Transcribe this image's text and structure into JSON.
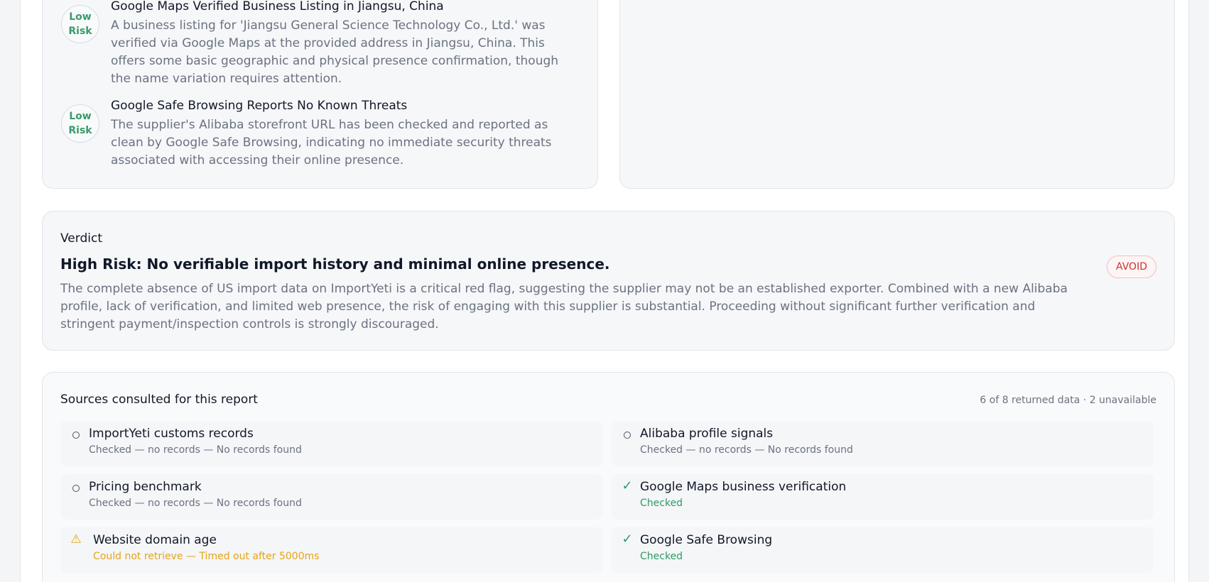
{
  "findings": [
    {
      "risk": "Low Risk",
      "title": "Google Maps Verified Business Listing in Jiangsu, China",
      "description": "A business listing for 'Jiangsu General Science Technology Co., Ltd.' was verified via Google Maps at the provided address in Jiangsu, China. This offers some basic geographic and physical presence confirmation, though the name variation requires attention."
    },
    {
      "risk": "Low Risk",
      "title": "Google Safe Browsing Reports No Known Threats",
      "description": "The supplier's Alibaba storefront URL has been checked and reported as clean by Google Safe Browsing, indicating no immediate security threats associated with accessing their online presence."
    }
  ],
  "verdict": {
    "label": "Verdict",
    "title": "High Risk: No verifiable import history and minimal online presence.",
    "badge": "AVOID",
    "description": "The complete absence of US import data on ImportYeti is a critical red flag, suggesting the supplier may not be an established exporter. Combined with a new Alibaba profile, lack of verification, and limited web presence, the risk of engaging with this supplier is substantial. Proceeding without significant further verification and stringent payment/inspection controls is strongly discouraged."
  },
  "sources": {
    "title": "Sources consulted for this report",
    "summary": "6 of 8 returned data · 2 unavailable",
    "items": [
      {
        "icon": "circle-icon",
        "name": "ImportYeti customs records",
        "status": "Checked — no records — No records found",
        "state": "none"
      },
      {
        "icon": "circle-icon",
        "name": "Alibaba profile signals",
        "status": "Checked — no records — No records found",
        "state": "none"
      },
      {
        "icon": "circle-icon",
        "name": "Pricing benchmark",
        "status": "Checked — no records — No records found",
        "state": "none"
      },
      {
        "icon": "check-icon",
        "name": "Google Maps business verification",
        "status": "Checked",
        "state": "ok"
      },
      {
        "icon": "warning-icon",
        "name": "Website domain age",
        "status": "Could not retrieve — Timed out after 5000ms",
        "state": "warn"
      },
      {
        "icon": "check-icon",
        "name": "Google Safe Browsing",
        "status": "Checked",
        "state": "ok"
      }
    ]
  },
  "colors": {
    "low_risk": "#3a9b6b",
    "avoid": "#d12f2f",
    "ok": "#2f9a63",
    "warn": "#e8a317"
  }
}
